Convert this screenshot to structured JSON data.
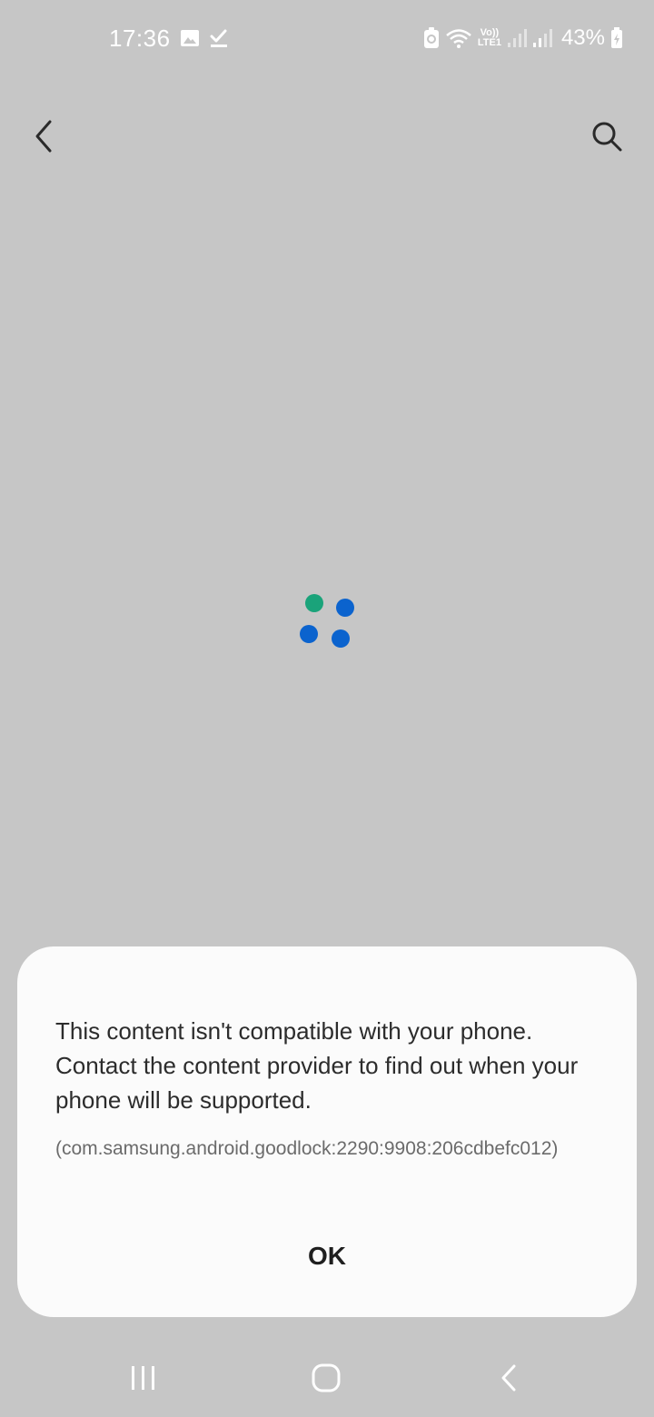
{
  "status_bar": {
    "time": "17:36",
    "battery_percent": "43%",
    "network_label_top": "Vo))",
    "network_label_bottom": "LTE1",
    "icons": [
      "gallery-icon",
      "check-download-icon",
      "battery-saver-icon",
      "wifi-icon",
      "volte-icon",
      "signal-icon",
      "signal-icon",
      "battery-icon"
    ]
  },
  "toolbar": {
    "icons": [
      "back-arrow-icon",
      "search-icon"
    ]
  },
  "loading": {
    "dot_colors": [
      "#1aa37a",
      "#0b63ce",
      "#0b63ce",
      "#0b63ce"
    ]
  },
  "dialog": {
    "message": "This content isn't compatible with your phone. Contact the content provider to find out when your phone will be supported.",
    "code": "(com.samsung.android.goodlock:2290:9908:206cdbefc012)",
    "ok_label": "OK"
  },
  "nav_bar": {
    "icons": [
      "recents-icon",
      "home-icon",
      "back-icon"
    ]
  },
  "colors": {
    "background": "#c6c6c6",
    "dialog_background": "#fbfbfb",
    "spinner_green": "#1aa37a",
    "spinner_blue": "#0b63ce"
  }
}
